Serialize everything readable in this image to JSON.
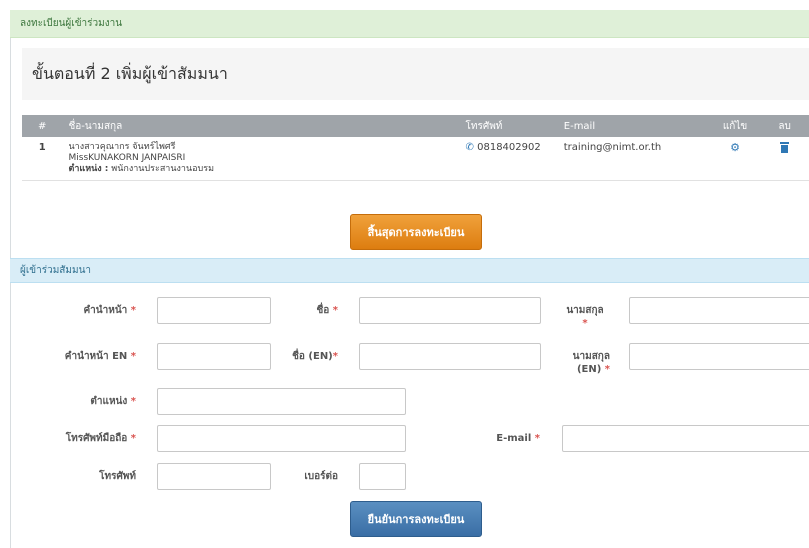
{
  "breadcrumb": "ลงทะเบียนผู้เข้าร่วมงาน",
  "step_title": "ขั้นตอนที่ 2 เพิ่มผู้เข้าสัมมนา",
  "table": {
    "headers": {
      "num": "#",
      "name": "ชื่อ-นามสกุล",
      "phone": "โทรศัพท์",
      "email": "E-mail",
      "edit": "แก้ไข",
      "delete": "ลบ"
    },
    "rows": [
      {
        "num": "1",
        "name_th": "นางสาวคุณากร จันทร์ไพศรี",
        "name_en": "MissKUNAKORN JANPAISRI",
        "position_label": "ตำแหน่ง :",
        "position_value": "พนักงานประสานงานอบรม",
        "phone": "0818402902",
        "email": "training@nimt.or.th"
      }
    ]
  },
  "end_button": "สิ้นสุดการลงทะเบียน",
  "section_title": "ผู้เข้าร่วมสัมมนา",
  "form": {
    "title_th": "คำนำหน้า",
    "first_name": "ชื่อ",
    "last_name": "นามสกุล",
    "title_en": "คำนำหน้า EN",
    "first_name_en": "ชื่อ (EN)",
    "last_name_en_1": "นามสกุล",
    "last_name_en_2": "(EN)",
    "position": "ตำแหน่ง",
    "mobile": "โทรศัพท์มือถือ",
    "email": "E-mail",
    "phone": "โทรศัพท์",
    "extension": "เบอร์ต่อ",
    "required_mark": "*"
  },
  "confirm_button": "ยืนยันการลงทะเบียน",
  "colors": {
    "success_bg": "#dff0d8",
    "info_bg": "#d9edf7",
    "orange": "#e68a1c",
    "blue": "#4a7fb5",
    "required": "#d9534f"
  }
}
